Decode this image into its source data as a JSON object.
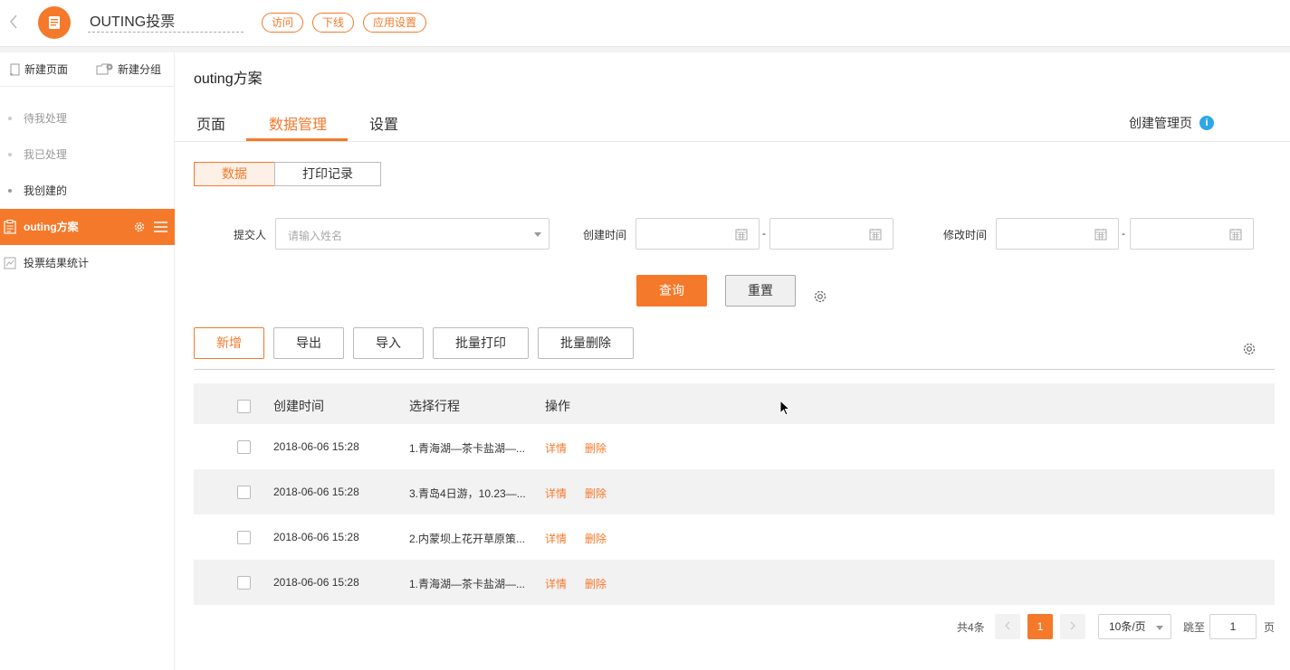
{
  "header": {
    "back_icon": "chevron-left-icon",
    "app_icon": "document-icon",
    "app_title": "OUTING投票",
    "actions": [
      "访问",
      "下线",
      "应用设置"
    ]
  },
  "sidebar": {
    "new_page": "新建页面",
    "new_group": "新建分组",
    "items": [
      {
        "label": "待我处理"
      },
      {
        "label": "我已处理"
      },
      {
        "label": "我创建的"
      },
      {
        "label": "outing方案"
      },
      {
        "label": "投票结果统计"
      }
    ]
  },
  "main": {
    "title": "outing方案",
    "tabs": [
      "页面",
      "数据管理",
      "设置"
    ],
    "active_tab": "数据管理",
    "create_manage_page": "创建管理页",
    "segments": [
      "数据",
      "打印记录"
    ]
  },
  "filters": {
    "submitter_label": "提交人",
    "submitter_placeholder": "请输入姓名",
    "created_label": "创建时间",
    "modified_label": "修改时间",
    "range_sep": "-",
    "query_label": "查询",
    "reset_label": "重置"
  },
  "toolbar": {
    "add": "新增",
    "export": "导出",
    "import": "导入",
    "batch_print": "批量打印",
    "batch_delete": "批量删除"
  },
  "table": {
    "headers": [
      "创建时间",
      "选择行程",
      "操作"
    ],
    "rows": [
      {
        "created": "2018-06-06 15:28",
        "trip": "1.青海湖—茶卡盐湖—...",
        "detail": "详情",
        "delete": "删除"
      },
      {
        "created": "2018-06-06 15:28",
        "trip": "3.青岛4日游，10.23—...",
        "detail": "详情",
        "delete": "删除"
      },
      {
        "created": "2018-06-06 15:28",
        "trip": "2.内蒙坝上花开草原策...",
        "detail": "详情",
        "delete": "删除"
      },
      {
        "created": "2018-06-06 15:28",
        "trip": "1.青海湖—茶卡盐湖—...",
        "detail": "详情",
        "delete": "删除"
      }
    ]
  },
  "pagination": {
    "total": "共4条",
    "current_page": "1",
    "page_size": "10条/页",
    "goto_label": "跳至",
    "goto_value": "1",
    "page_suffix": "页"
  },
  "colors": {
    "accent": "#f5792a",
    "info": "#2ea7e8"
  }
}
